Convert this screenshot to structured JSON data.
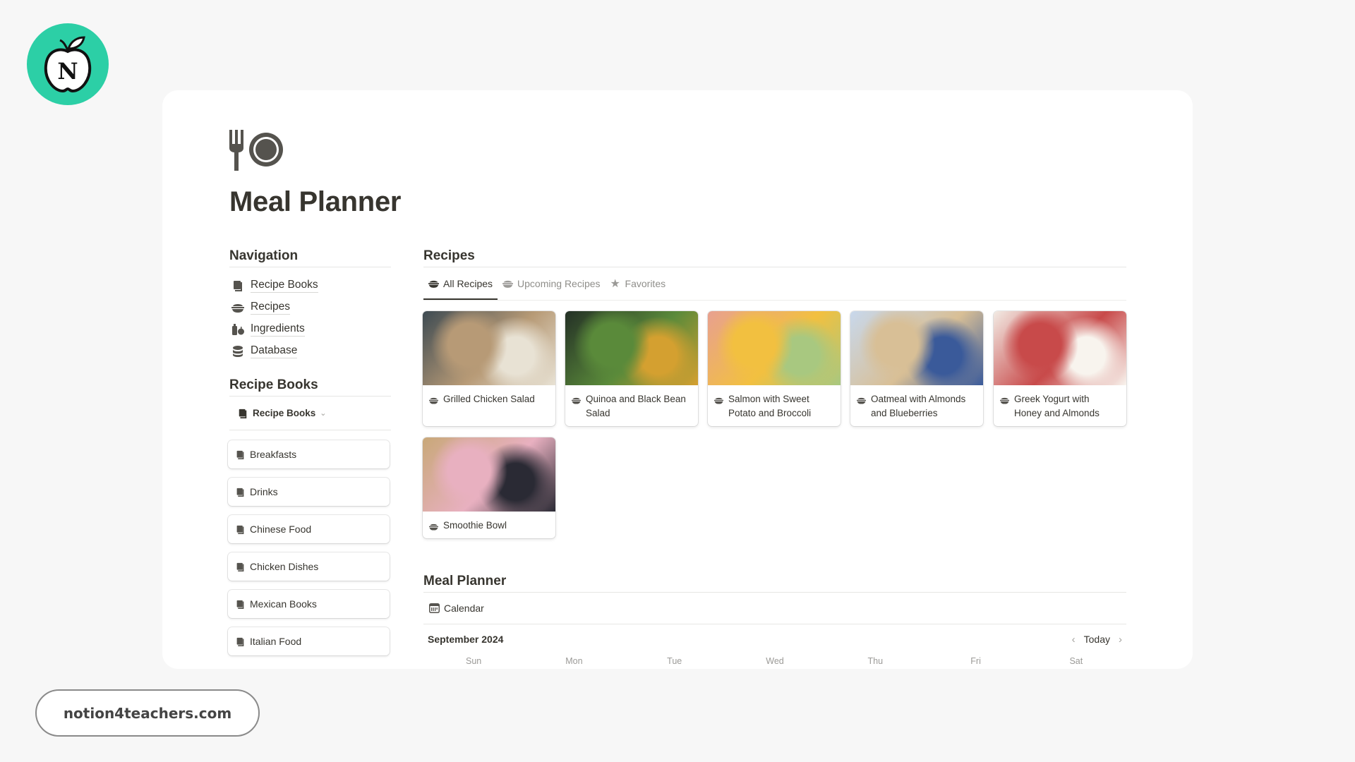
{
  "branding": {
    "logo_letter": "N",
    "logo_color": "#2ccfa6",
    "website": "notion4teachers.com"
  },
  "page": {
    "icon": "fork-and-plate-icon",
    "title": "Meal Planner"
  },
  "navigation": {
    "heading": "Navigation",
    "items": [
      {
        "label": "Recipe Books",
        "icon": "book-icon"
      },
      {
        "label": "Recipes",
        "icon": "bowl-icon"
      },
      {
        "label": "Ingredients",
        "icon": "ingredients-icon"
      },
      {
        "label": "Database",
        "icon": "database-icon"
      }
    ]
  },
  "recipe_books": {
    "heading": "Recipe Books",
    "view_selector": {
      "label": "Recipe Books",
      "icon": "book-icon"
    },
    "items": [
      {
        "label": "Breakfasts"
      },
      {
        "label": "Drinks"
      },
      {
        "label": "Chinese Food"
      },
      {
        "label": "Chicken Dishes"
      },
      {
        "label": "Mexican Books"
      },
      {
        "label": "Italian Food"
      }
    ]
  },
  "recipes": {
    "heading": "Recipes",
    "tabs": [
      {
        "label": "All Recipes",
        "icon": "bowl-icon",
        "active": true
      },
      {
        "label": "Upcoming Recipes",
        "icon": "bowl-icon",
        "active": false
      },
      {
        "label": "Favorites",
        "icon": "star-icon",
        "active": false
      }
    ],
    "cards": [
      {
        "title": "Grilled Chicken Salad",
        "image": "grilled-chicken-salad-photo",
        "colors": [
          "#3d4a52",
          "#b79a76",
          "#e8e2d4"
        ]
      },
      {
        "title": "Quinoa and Black Bean Salad",
        "image": "quinoa-salad-photo",
        "colors": [
          "#243026",
          "#5a8a3a",
          "#d4a030"
        ]
      },
      {
        "title": "Salmon with Sweet Potato and Broccoli",
        "image": "salmon-bowl-photo",
        "colors": [
          "#e8a090",
          "#f2c040",
          "#a8c880"
        ]
      },
      {
        "title": "Oatmeal with Almonds and Blueberries",
        "image": "oatmeal-photo",
        "colors": [
          "#c8d8ec",
          "#d8bf96",
          "#3a5a9a"
        ]
      },
      {
        "title": "Greek Yogurt with Honey and Almonds",
        "image": "greek-yogurt-parfait-photo",
        "colors": [
          "#f2ebe4",
          "#c84a4a",
          "#f8f4ee"
        ]
      },
      {
        "title": "Smoothie Bowl",
        "image": "berry-smoothie-photo",
        "colors": [
          "#c8a878",
          "#e8b0c0",
          "#2a2a34"
        ]
      }
    ]
  },
  "meal_planner": {
    "heading": "Meal Planner",
    "view_tab": {
      "label": "Calendar",
      "icon": "calendar-icon"
    },
    "month": "September 2024",
    "today_label": "Today",
    "weekdays": [
      "Sun",
      "Mon",
      "Tue",
      "Wed",
      "Thu",
      "Fri",
      "Sat"
    ]
  }
}
